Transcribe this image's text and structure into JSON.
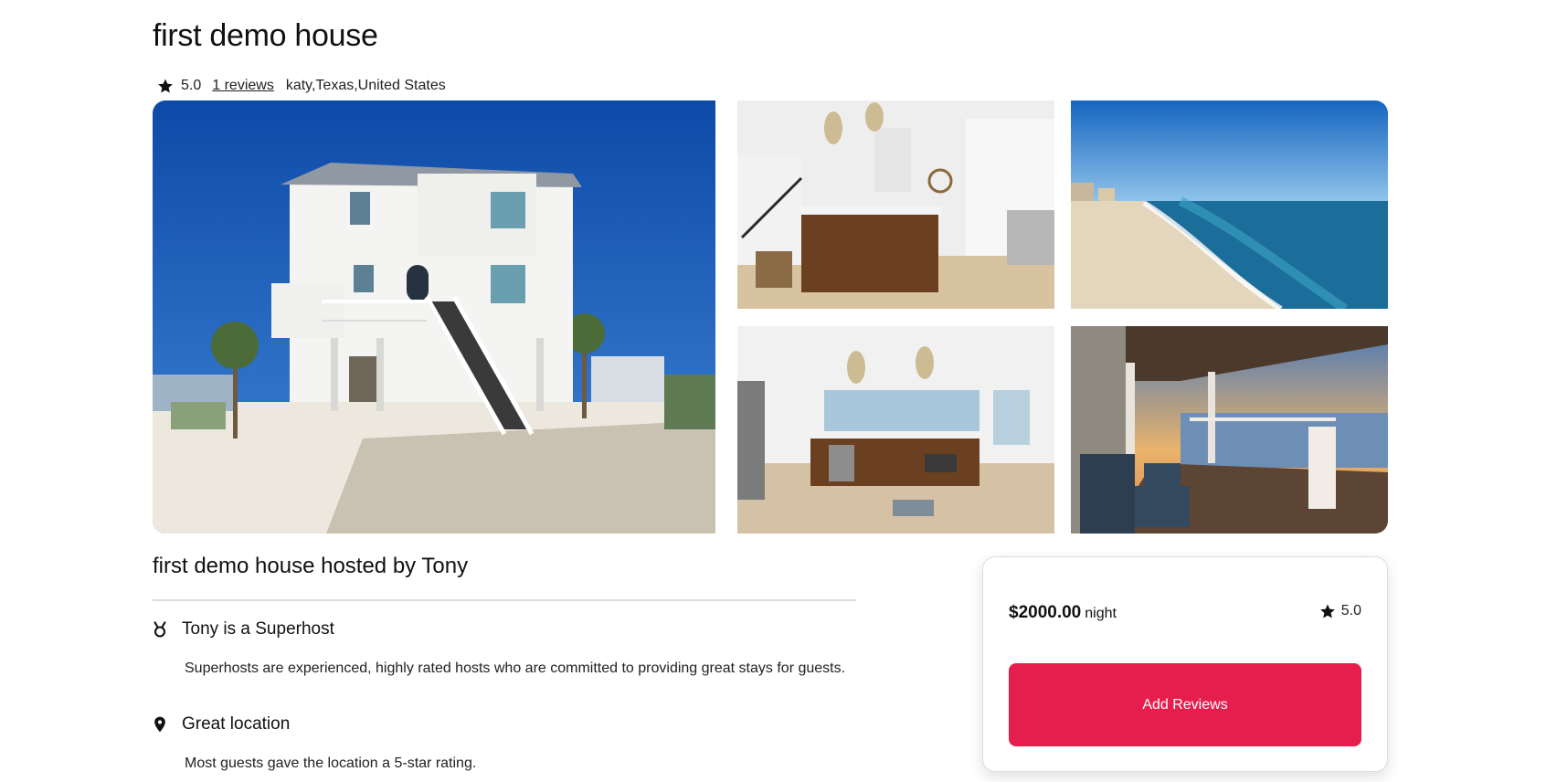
{
  "listing": {
    "title": "first demo house",
    "rating": "5.0",
    "reviews_link": "1 reviews",
    "location": "katy,Texas,United States"
  },
  "gallery": {
    "images": [
      {
        "name": "house-exterior-photo"
      },
      {
        "name": "kitchen-photo"
      },
      {
        "name": "beach-photo"
      },
      {
        "name": "living-kitchen-photo"
      },
      {
        "name": "porch-sunset-photo"
      }
    ]
  },
  "host": {
    "heading": "first demo house hosted by Tony"
  },
  "features": [
    {
      "icon": "medal-icon",
      "title": "Tony is a Superhost",
      "description": "Superhosts are experienced, highly rated hosts who are committed to providing great stays for guests."
    },
    {
      "icon": "location-pin-icon",
      "title": "Great location",
      "description": "Most guests gave the location a 5-star rating."
    }
  ],
  "booking": {
    "price": "$2000.00",
    "unit": "night",
    "rating": "5.0",
    "button_label": "Add Reviews"
  },
  "colors": {
    "accent": "#e61e4d",
    "divider": "#dddddd",
    "text": "#222222"
  }
}
